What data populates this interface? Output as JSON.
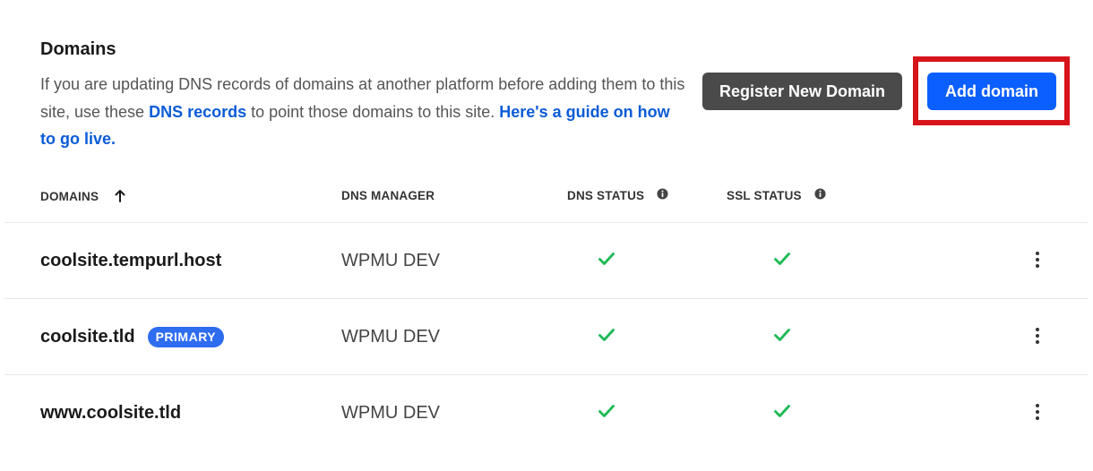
{
  "header": {
    "title": "Domains",
    "description_part1": "If you are updating DNS records of domains at another platform before adding them to this site, use these ",
    "dns_records_link": "DNS records",
    "description_part2": " to point those domains to this site. ",
    "guide_link": "Here's a guide on how to go live."
  },
  "buttons": {
    "register_label": "Register New Domain",
    "add_label": "Add domain"
  },
  "table": {
    "columns": {
      "domains": "DOMAINS",
      "dns_manager": "DNS MANAGER",
      "dns_status": "DNS STATUS",
      "ssl_status": "SSL STATUS"
    },
    "rows": [
      {
        "domain": "coolsite.tempurl.host",
        "badge": "",
        "dns_manager": "WPMU DEV",
        "dns_status": "ok",
        "ssl_status": "ok"
      },
      {
        "domain": "coolsite.tld",
        "badge": "PRIMARY",
        "dns_manager": "WPMU DEV",
        "dns_status": "ok",
        "ssl_status": "ok"
      },
      {
        "domain": "www.coolsite.tld",
        "badge": "",
        "dns_manager": "WPMU DEV",
        "dns_status": "ok",
        "ssl_status": "ok"
      }
    ]
  },
  "colors": {
    "accent": "#0b5fff",
    "link": "#0a5bd7",
    "success": "#1db954",
    "highlight": "#d7141a",
    "secondary_button": "#4a4a4a",
    "badge": "#2e6cf0"
  },
  "icons": {
    "sort": "arrow-up-icon",
    "info": "info-icon",
    "status_ok": "check-icon",
    "row_menu": "kebab-menu-icon"
  }
}
